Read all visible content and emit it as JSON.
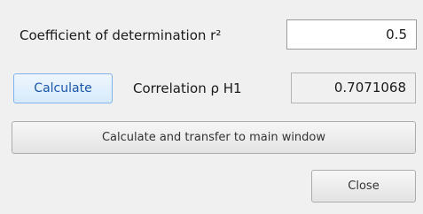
{
  "dialog": {
    "coefficient_label": "Coefficient of determination r²",
    "coefficient_value": "0.5",
    "calculate_label": "Calculate",
    "correlation_label": "Correlation ρ H1",
    "correlation_value": "0.7071068",
    "transfer_label": "Calculate and transfer to main window",
    "close_label": "Close"
  }
}
